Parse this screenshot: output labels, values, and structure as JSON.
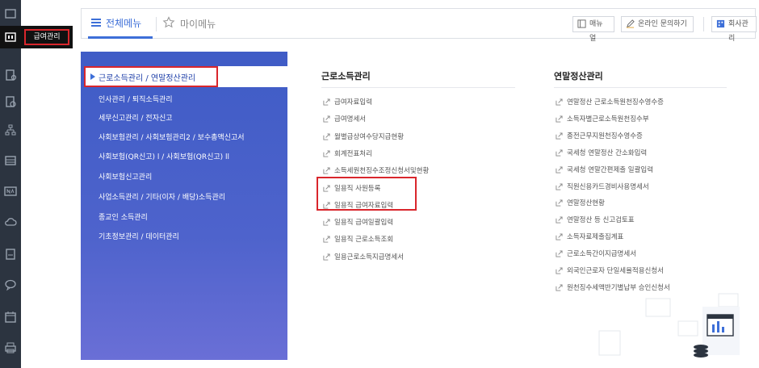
{
  "sidebar": {
    "active_label": "급여관리"
  },
  "topbar": {
    "tab_all_menu": "전체메뉴",
    "tab_my_menu": "마이메뉴",
    "btn_manual": "매뉴얼",
    "btn_inquiry": "온라인 문의하기",
    "btn_company": "회사관리"
  },
  "menu": {
    "active": "근로소득관리 / 연말정산관리",
    "items": [
      "인사관리 / 퇴직소득관리",
      "세무신고관리 / 전자신고",
      "사회보험관리 / 사회보험관리2 / 보수총액신고서",
      "사회보험(QR신고) l  / 사회보험(QR신고) ll",
      "사회보험신고관리",
      "사업소득관리 / 기타(이자 / 배당)소득관리",
      "종교인 소득관리",
      "기초정보관리 / 데이터관리"
    ]
  },
  "column_left": {
    "title": "근로소득관리",
    "links": [
      "급여자료입력",
      "급여명세서",
      "월별급상여수당지급현황",
      "회계전표처리",
      "소득세원천징수조정신청서및현황",
      "일용직 사원등록",
      "일용직 급여자료입력",
      "일용직 급여일괄입력",
      "일용직 근로소득조회",
      "일용근로소득지급명세서"
    ]
  },
  "column_right": {
    "title": "연말정산관리",
    "links": [
      "연말정산 근로소득원천징수영수증",
      "소득자별근로소득원천징수부",
      "종전근무지원천징수영수증",
      "국세청 연말정산 간소화입력",
      "국세청 연말간편제출 일괄입력",
      "직원신용카드경비사용명세서",
      "연말정산현황",
      "연말정산 등 신고검토표",
      "소득자료제출집계표",
      "근로소득간이지급명세서",
      "외국인근로자 단일세율적용신청서",
      "원천징수세액반기별납부 승인신청서"
    ]
  },
  "colors": {
    "rail": "#2c3440",
    "accent": "#3d6fd8",
    "panel": "#4e63cc",
    "highlight": "#d9262c"
  }
}
